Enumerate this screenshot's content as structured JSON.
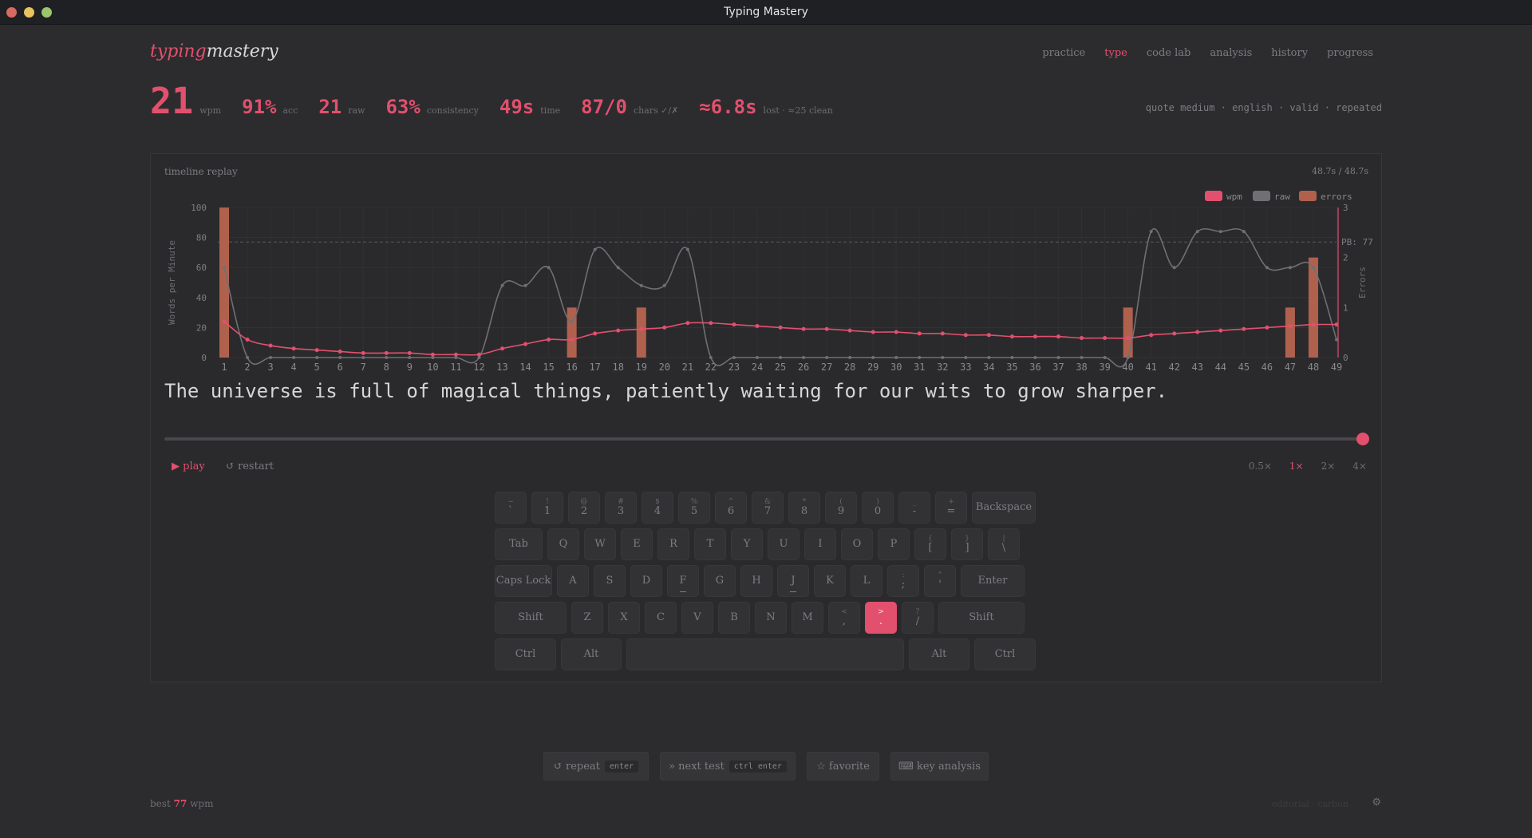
{
  "window": {
    "title": "Typing Mastery"
  },
  "logo": {
    "part1": "typing",
    "part2": "mastery"
  },
  "nav": [
    {
      "label": "practice",
      "active": false
    },
    {
      "label": "type",
      "active": true
    },
    {
      "label": "code lab",
      "active": false
    },
    {
      "label": "analysis",
      "active": false
    },
    {
      "label": "history",
      "active": false
    },
    {
      "label": "progress",
      "active": false
    }
  ],
  "stats": [
    {
      "value": "21",
      "label": "wpm"
    },
    {
      "value": "91%",
      "label": "acc"
    },
    {
      "value": "21",
      "label": "raw"
    },
    {
      "value": "63%",
      "label": "consistency"
    },
    {
      "value": "49s",
      "label": "time"
    },
    {
      "value": "87/0",
      "label": "chars ✓/✗"
    },
    {
      "value": "≈6.8s",
      "label": "lost · ≈25 clean"
    }
  ],
  "test_tags": "quote medium · english · valid · repeated",
  "panel": {
    "title": "timeline replay",
    "time": "48.7s / 48.7s"
  },
  "chart_data": {
    "type": "line",
    "x": [
      1,
      2,
      3,
      4,
      5,
      6,
      7,
      8,
      9,
      10,
      11,
      12,
      13,
      14,
      15,
      16,
      17,
      18,
      19,
      20,
      21,
      22,
      23,
      24,
      25,
      26,
      27,
      28,
      29,
      30,
      31,
      32,
      33,
      34,
      35,
      36,
      37,
      38,
      39,
      40,
      41,
      42,
      43,
      44,
      45,
      46,
      47,
      48,
      49
    ],
    "ylabel": "Words per Minute",
    "y2label": "Errors",
    "ylim": [
      0,
      100
    ],
    "y2lim": [
      0,
      3
    ],
    "yticks": [
      0,
      20,
      40,
      60,
      80,
      100
    ],
    "y2ticks": [
      0,
      1,
      2,
      3
    ],
    "legend": [
      "wpm",
      "raw",
      "errors"
    ],
    "legend_position": "top-right",
    "pb": {
      "label": "PB: 77",
      "value": 77
    },
    "series": [
      {
        "name": "wpm",
        "color": "#e2506e",
        "values": [
          24,
          12,
          8,
          6,
          5,
          4,
          3,
          3,
          3,
          2,
          2,
          2,
          6,
          9,
          12,
          12,
          16,
          18,
          19,
          20,
          23,
          23,
          22,
          21,
          20,
          19,
          19,
          18,
          17,
          17,
          16,
          16,
          15,
          15,
          14,
          14,
          14,
          13,
          13,
          13,
          15,
          16,
          17,
          18,
          19,
          20,
          21,
          22,
          22
        ]
      },
      {
        "name": "raw",
        "color": "#707074",
        "values": [
          60,
          0,
          0,
          0,
          0,
          0,
          0,
          0,
          0,
          0,
          0,
          0,
          48,
          48,
          60,
          24,
          72,
          60,
          48,
          48,
          72,
          0,
          0,
          0,
          0,
          0,
          0,
          0,
          0,
          0,
          0,
          0,
          0,
          0,
          0,
          0,
          0,
          0,
          0,
          0,
          84,
          60,
          84,
          84,
          84,
          60,
          60,
          60,
          12
        ]
      },
      {
        "name": "errors",
        "color": "#b0614e",
        "values": [
          3,
          0,
          0,
          0,
          0,
          0,
          0,
          0,
          0,
          0,
          0,
          0,
          0,
          0,
          0,
          1,
          0,
          0,
          1,
          0,
          0,
          0,
          0,
          0,
          0,
          0,
          0,
          0,
          0,
          0,
          0,
          0,
          0,
          0,
          0,
          0,
          0,
          0,
          0,
          1,
          0,
          0,
          0,
          0,
          0,
          0,
          1,
          2,
          0
        ]
      }
    ]
  },
  "quote": "The universe is full of magical things, patiently waiting for our wits to grow sharper.",
  "replay": {
    "progress": 1.0,
    "play_label": "▶ play",
    "restart_label": "↺ restart"
  },
  "speeds": [
    {
      "label": "0.5×",
      "active": false
    },
    {
      "label": "1×",
      "active": true
    },
    {
      "label": "2×",
      "active": false
    },
    {
      "label": "4×",
      "active": false
    }
  ],
  "keyboard": {
    "highlight": ".",
    "rows": [
      [
        {
          "sh": "~",
          "k": "`"
        },
        {
          "sh": "!",
          "k": "1"
        },
        {
          "sh": "@",
          "k": "2"
        },
        {
          "sh": "#",
          "k": "3"
        },
        {
          "sh": "$",
          "k": "4"
        },
        {
          "sh": "%",
          "k": "5"
        },
        {
          "sh": "^",
          "k": "6"
        },
        {
          "sh": "&",
          "k": "7"
        },
        {
          "sh": "*",
          "k": "8"
        },
        {
          "sh": "(",
          "k": "9"
        },
        {
          "sh": ")",
          "k": "0"
        },
        {
          "sh": "_",
          "k": "-"
        },
        {
          "sh": "+",
          "k": "="
        },
        {
          "k": "Backspace",
          "mod": true
        }
      ],
      [
        {
          "k": "Tab",
          "mod": true
        },
        {
          "k": "Q"
        },
        {
          "k": "W"
        },
        {
          "k": "E"
        },
        {
          "k": "R"
        },
        {
          "k": "T"
        },
        {
          "k": "Y"
        },
        {
          "k": "U"
        },
        {
          "k": "I"
        },
        {
          "k": "O"
        },
        {
          "k": "P"
        },
        {
          "sh": "{",
          "k": "["
        },
        {
          "sh": "}",
          "k": "]"
        },
        {
          "sh": "|",
          "k": "\\"
        }
      ],
      [
        {
          "k": "Caps Lock",
          "mod": true
        },
        {
          "k": "A"
        },
        {
          "k": "S"
        },
        {
          "k": "D"
        },
        {
          "k": "F",
          "bump": true
        },
        {
          "k": "G"
        },
        {
          "k": "H"
        },
        {
          "k": "J",
          "bump": true
        },
        {
          "k": "K"
        },
        {
          "k": "L"
        },
        {
          "sh": ":",
          "k": ";"
        },
        {
          "sh": "\"",
          "k": "'"
        },
        {
          "k": "Enter",
          "mod": true
        }
      ],
      [
        {
          "k": "Shift",
          "mod": true
        },
        {
          "k": "Z"
        },
        {
          "k": "X"
        },
        {
          "k": "C"
        },
        {
          "k": "V"
        },
        {
          "k": "B"
        },
        {
          "k": "N"
        },
        {
          "k": "M"
        },
        {
          "sh": "<",
          "k": ","
        },
        {
          "sh": ">",
          "k": "."
        },
        {
          "sh": "?",
          "k": "/"
        },
        {
          "k": "Shift",
          "mod": true
        }
      ],
      [
        {
          "k": "Ctrl",
          "mod": true
        },
        {
          "k": "Alt",
          "mod": true
        },
        {
          "k": "",
          "space": true
        },
        {
          "k": "Alt",
          "mod": true
        },
        {
          "k": "Ctrl",
          "mod": true
        }
      ]
    ]
  },
  "actions": {
    "repeat": {
      "label": "↺ repeat",
      "kbd": "enter"
    },
    "next": {
      "label": "» next test",
      "kbd": "ctrl enter"
    },
    "favorite": {
      "label": "☆ favorite"
    },
    "key_analysis": {
      "label": "⌨ key analysis"
    }
  },
  "footer": {
    "best_prefix": "best",
    "best_value": "77",
    "best_suffix": "wpm",
    "theme": "editorial · carbon",
    "gear_icon": "⚙"
  }
}
